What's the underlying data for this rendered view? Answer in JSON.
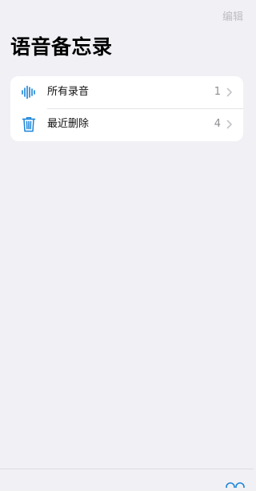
{
  "header": {
    "edit_label": "编辑",
    "title": "语音备忘录"
  },
  "folders": [
    {
      "label": "所有录音",
      "count": "1",
      "icon": "waveform-icon"
    },
    {
      "label": "最近删除",
      "count": "4",
      "icon": "trash-icon"
    }
  ],
  "colors": {
    "accent": "#1a84d8",
    "background": "#f1f0f5",
    "card": "#ffffff",
    "muted_text": "#8e8e93",
    "edit_text": "#bdbdc2"
  }
}
